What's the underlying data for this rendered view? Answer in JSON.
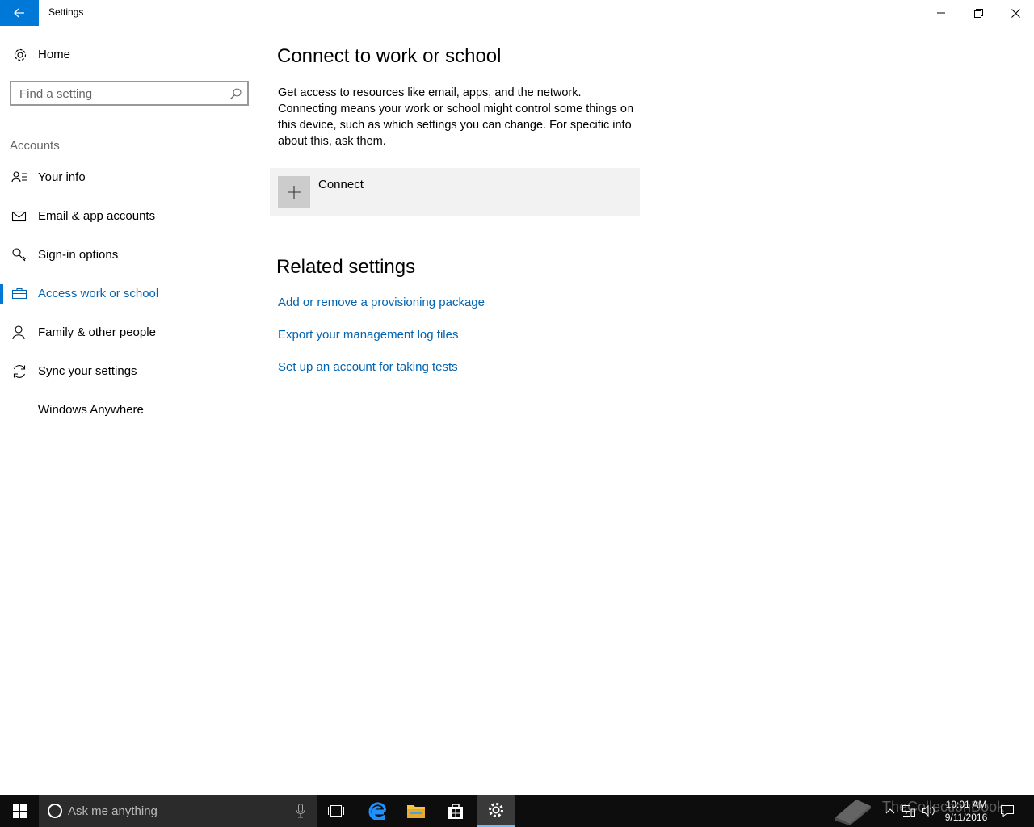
{
  "window": {
    "title": "Settings"
  },
  "sidebar": {
    "home_label": "Home",
    "search_placeholder": "Find a setting",
    "section_label": "Accounts",
    "items": [
      {
        "label": "Your info",
        "icon": "person-card-icon"
      },
      {
        "label": "Email & app accounts",
        "icon": "mail-icon"
      },
      {
        "label": "Sign-in options",
        "icon": "key-icon"
      },
      {
        "label": "Access work or school",
        "icon": "briefcase-icon",
        "active": true
      },
      {
        "label": "Family & other people",
        "icon": "person-icon"
      },
      {
        "label": "Sync your settings",
        "icon": "sync-icon"
      },
      {
        "label": "Windows Anywhere",
        "icon": ""
      }
    ]
  },
  "main": {
    "title": "Connect to work or school",
    "description": "Get access to resources like email, apps, and the network. Connecting means your work or school might control some things on this device, such as which settings you can change. For specific info about this, ask them.",
    "connect_label": "Connect",
    "related_title": "Related settings",
    "related_links": [
      "Add or remove a provisioning package",
      "Export your management log files",
      "Set up an account for taking tests"
    ]
  },
  "taskbar": {
    "search_placeholder": "Ask me anything",
    "time": "10:01 AM",
    "date": "9/11/2016",
    "apps": [
      "task-view-icon",
      "edge-icon",
      "file-explorer-icon",
      "store-icon",
      "settings-icon"
    ]
  },
  "watermark": {
    "text": "TheCollectionBook"
  },
  "colors": {
    "accent": "#0078d7",
    "link": "#0063b1",
    "taskbar": "#0d0d0d",
    "tile": "#f2f2f2"
  }
}
